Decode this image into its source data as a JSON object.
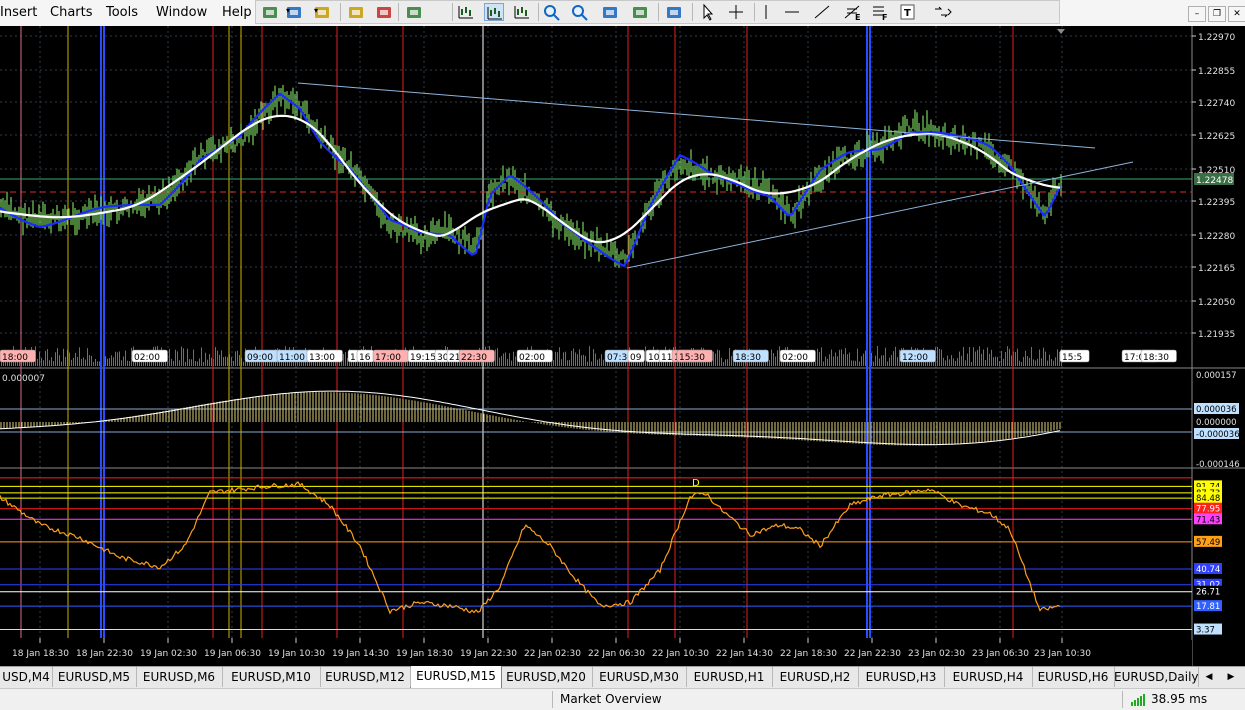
{
  "menu": [
    "Insert",
    "Charts",
    "Tools",
    "Window",
    "Help"
  ],
  "toolbar_icons": [
    "new-chart-icon",
    "profiles-icon",
    "data-window-icon",
    "navigator-icon",
    "strategy-tester-icon",
    "new-order-icon",
    "bar-chart-icon",
    "candlestick-icon",
    "line-chart-icon",
    "zoom-in-icon",
    "zoom-out-icon",
    "tile-windows-icon",
    "auto-scroll-icon",
    "chart-shift-icon",
    "cursor-icon",
    "crosshair-icon",
    "vertical-line-icon",
    "horizontal-line-icon",
    "trendline-icon",
    "fibonacci-icon",
    "text-label-icon",
    "text-icon",
    "arrows-icon"
  ],
  "window_controls": {
    "minimize": "–",
    "restore": "❐"
  },
  "colors": {
    "background": "#000000",
    "grid": "#2e3d4f",
    "price": "#79d15c",
    "ma_fast": "#1a2dff",
    "ma_slow": "#ffffff",
    "trendline": "#8fb4dc",
    "osc_line": "#ff9f1a",
    "hist": "#e0cf7a",
    "volume": "#20a040"
  },
  "chart": {
    "symbol": "EURUSD,M15",
    "price_labels": [
      "1.22970",
      "1.22855",
      "1.22740",
      "1.22625",
      "1.22510",
      "1.22395",
      "1.22280",
      "1.22165",
      "1.22050",
      "1.21935"
    ],
    "current_price": "1.22478",
    "time_labels": [
      "18 Jan 18:30",
      "18 Jan 22:30",
      "19 Jan 02:30",
      "19 Jan 06:30",
      "19 Jan 10:30",
      "19 Jan 14:30",
      "19 Jan 18:30",
      "19 Jan 22:30",
      "22 Jan 02:30",
      "22 Jan 06:30",
      "22 Jan 10:30",
      "22 Jan 14:30",
      "22 Jan 18:30",
      "22 Jan 22:30",
      "23 Jan 02:30",
      "23 Jan 06:30",
      "23 Jan 10:30"
    ],
    "event_tags": [
      {
        "text": "18:00",
        "color": "#ffb0b0"
      },
      {
        "text": "02:00",
        "color": "#ffffff"
      },
      {
        "text": "09:00",
        "color": "#bfe0ff"
      },
      {
        "text": "11:00",
        "color": "#bfe0ff"
      },
      {
        "text": "13:00",
        "color": "#ffffff"
      },
      {
        "text": "1",
        "color": "#ffffff"
      },
      {
        "text": "16",
        "color": "#ffffff"
      },
      {
        "text": "17:00",
        "color": "#ffb0b0"
      },
      {
        "text": "19:15",
        "color": "#ffffff"
      },
      {
        "text": "30",
        "color": "#ffffff"
      },
      {
        "text": "21",
        "color": "#ffffff"
      },
      {
        "text": "22:30",
        "color": "#ffb0b0"
      },
      {
        "text": "02:00",
        "color": "#ffffff"
      },
      {
        "text": "07:30",
        "color": "#bfe0ff"
      },
      {
        "text": "09",
        "color": "#ffffff"
      },
      {
        "text": "10",
        "color": "#ffffff"
      },
      {
        "text": "11",
        "color": "#ffffff"
      },
      {
        "text": "12:00",
        "color": "#ffb0b0"
      },
      {
        "text": "15:30",
        "color": "#ffb0b0"
      },
      {
        "text": "18:30",
        "color": "#bfe0ff"
      },
      {
        "text": "02:00",
        "color": "#ffffff"
      },
      {
        "text": "12:00",
        "color": "#bfe0ff"
      },
      {
        "text": "15:5",
        "color": "#ffffff"
      },
      {
        "text": "17:00",
        "color": "#ffffff"
      },
      {
        "text": "18:30",
        "color": "#ffffff"
      }
    ]
  },
  "macd": {
    "top_label": "0.000007",
    "scale_labels": [
      "0.000157",
      "0.000036",
      "0.000000",
      "-0.000036",
      "-0.000146"
    ]
  },
  "oscillator": {
    "levels": [
      {
        "text": "91.74",
        "color": "#ffff00"
      },
      {
        "text": "87.73",
        "color": "#ffff00"
      },
      {
        "text": "84.48",
        "color": "#ffff00"
      },
      {
        "text": "77.95",
        "color": "#ff2020"
      },
      {
        "text": "71.43",
        "color": "#ff40ff"
      },
      {
        "text": "57.49",
        "color": "#ff9f1a"
      },
      {
        "text": "40.74",
        "color": "#3040ff"
      },
      {
        "text": "31.02",
        "color": "#3040ff"
      },
      {
        "text": "26.71",
        "color": "#000000"
      },
      {
        "text": "17.81",
        "color": "#3060ff"
      },
      {
        "text": "3.37",
        "color": "#bfe0ff"
      }
    ],
    "marker": "D"
  },
  "tabs": [
    "USD,M4",
    "EURUSD,M5",
    "EURUSD,M6",
    "EURUSD,M10",
    "EURUSD,M12",
    "EURUSD,M15",
    "EURUSD,M20",
    "EURUSD,M30",
    "EURUSD,H1",
    "EURUSD,H2",
    "EURUSD,H3",
    "EURUSD,H4",
    "EURUSD,H6",
    "EURUSD,Daily"
  ],
  "active_tab": "EURUSD,M15",
  "tab_arrows": {
    "left": "◀",
    "right": "▶"
  },
  "status": {
    "market_overview": "Market Overview",
    "ping": "38.95 ms"
  }
}
